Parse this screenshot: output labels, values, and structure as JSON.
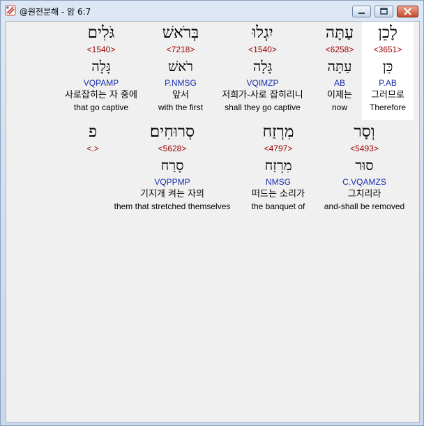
{
  "window": {
    "title": "@원전분해 - 암 6:7"
  },
  "words": [
    {
      "hebrew": "לָכֵן",
      "strong": "<3651>",
      "lemma": "כֵּן",
      "morph": "P.AB",
      "korean": "그러므로",
      "english": "Therefore",
      "selected": true
    },
    {
      "hebrew": "עַתָּה",
      "strong": "<6258>",
      "lemma": "עַתָּה",
      "morph": "AB",
      "korean": "이제는",
      "english": "now"
    },
    {
      "hebrew": "יִגְלוּ",
      "strong": "<1540>",
      "lemma": "גָּלָה",
      "morph": "VQIMZP",
      "korean": "저희가-사로 잡히리니",
      "english": "shall they go captive"
    },
    {
      "hebrew": "בְּרֹאשׁ",
      "strong": "<7218>",
      "lemma": "רֹאשׁ",
      "morph": "P.NMSG",
      "korean": "앞서",
      "english": "with the first"
    },
    {
      "hebrew": "גֹּלִים",
      "strong": "<1540>",
      "lemma": "גָּלָה",
      "morph": "VQPAMP",
      "korean": "사로잡히는 자 중에",
      "english": "that go captive"
    },
    {
      "hebrew": "וְסָר",
      "strong": "<5493>",
      "lemma": "סוּר",
      "morph": "C.VQAMZS",
      "korean": "그치리라",
      "english": "and-shall be removed"
    },
    {
      "hebrew": "מִרְזַח",
      "strong": "<4797>",
      "lemma": "מִרְזַח",
      "morph": "NMSG",
      "korean": "떠드는 소리가",
      "english": "the banquet of"
    },
    {
      "hebrew": "סְרוּחִים׃",
      "strong": "<5628>",
      "lemma": "סָרַח",
      "morph": "VQPPMP",
      "korean": "기지개 켜는 자의",
      "english": "them that stretched themselves"
    },
    {
      "hebrew": "פ",
      "strong": "<.>",
      "lemma": "",
      "morph": "",
      "korean": "",
      "english": ""
    }
  ]
}
